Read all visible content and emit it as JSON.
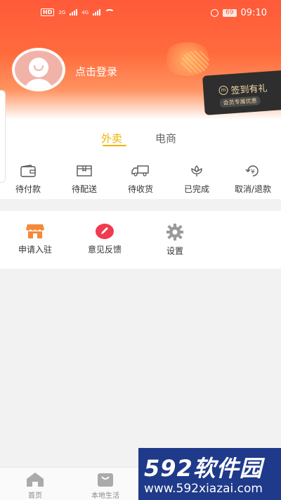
{
  "status_bar": {
    "hd": "HD",
    "net1": "2G",
    "net2": "4G",
    "battery": "69",
    "time": "09:10"
  },
  "profile": {
    "login_text": "点击登录"
  },
  "sign_card": {
    "title": "签到有礼",
    "subtitle": "会员专属优惠"
  },
  "tabs": [
    {
      "label": "外卖",
      "active": true
    },
    {
      "label": "电商",
      "active": false
    }
  ],
  "orders": [
    {
      "label": "待付款",
      "icon": "wallet-icon"
    },
    {
      "label": "待配送",
      "icon": "package-icon"
    },
    {
      "label": "待收货",
      "icon": "truck-icon"
    },
    {
      "label": "已完成",
      "icon": "flower-icon"
    },
    {
      "label": "取消/退款",
      "icon": "refund-icon"
    }
  ],
  "services": [
    {
      "label": "申请入驻",
      "icon": "shop-icon"
    },
    {
      "label": "意见反馈",
      "icon": "pencil-icon"
    },
    {
      "label": "设置",
      "icon": "gear-icon"
    }
  ],
  "bottom_nav": [
    {
      "label": "首页",
      "icon": "home-icon"
    },
    {
      "label": "本地生活",
      "icon": "shopping-bag-icon"
    }
  ],
  "watermark": {
    "brand": "592软件园",
    "url": "www.592xiazai.com"
  },
  "colors": {
    "header_start": "#ff5a3a",
    "tab_active": "#f0b400",
    "shop_orange": "#f5893a",
    "feedback_red": "#ef3b4f",
    "gear_gray": "#9a9a9a"
  }
}
